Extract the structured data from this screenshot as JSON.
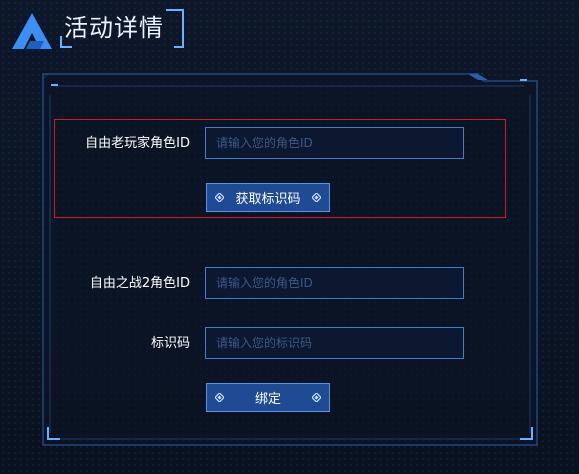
{
  "header": {
    "title": "活动详情"
  },
  "form": {
    "old_player": {
      "label": "自由老玩家角色ID",
      "placeholder": "请输入您的角色ID",
      "button": "获取标识码"
    },
    "ff2": {
      "label": "自由之战2角色ID",
      "placeholder": "请输入您的角色ID"
    },
    "code": {
      "label": "标识码",
      "placeholder": "请输入您的标识码"
    },
    "bind_button": "绑定"
  },
  "colors": {
    "accent": "#3f7dd0",
    "highlight": "#d41a1a",
    "button": "#1f4b94"
  }
}
